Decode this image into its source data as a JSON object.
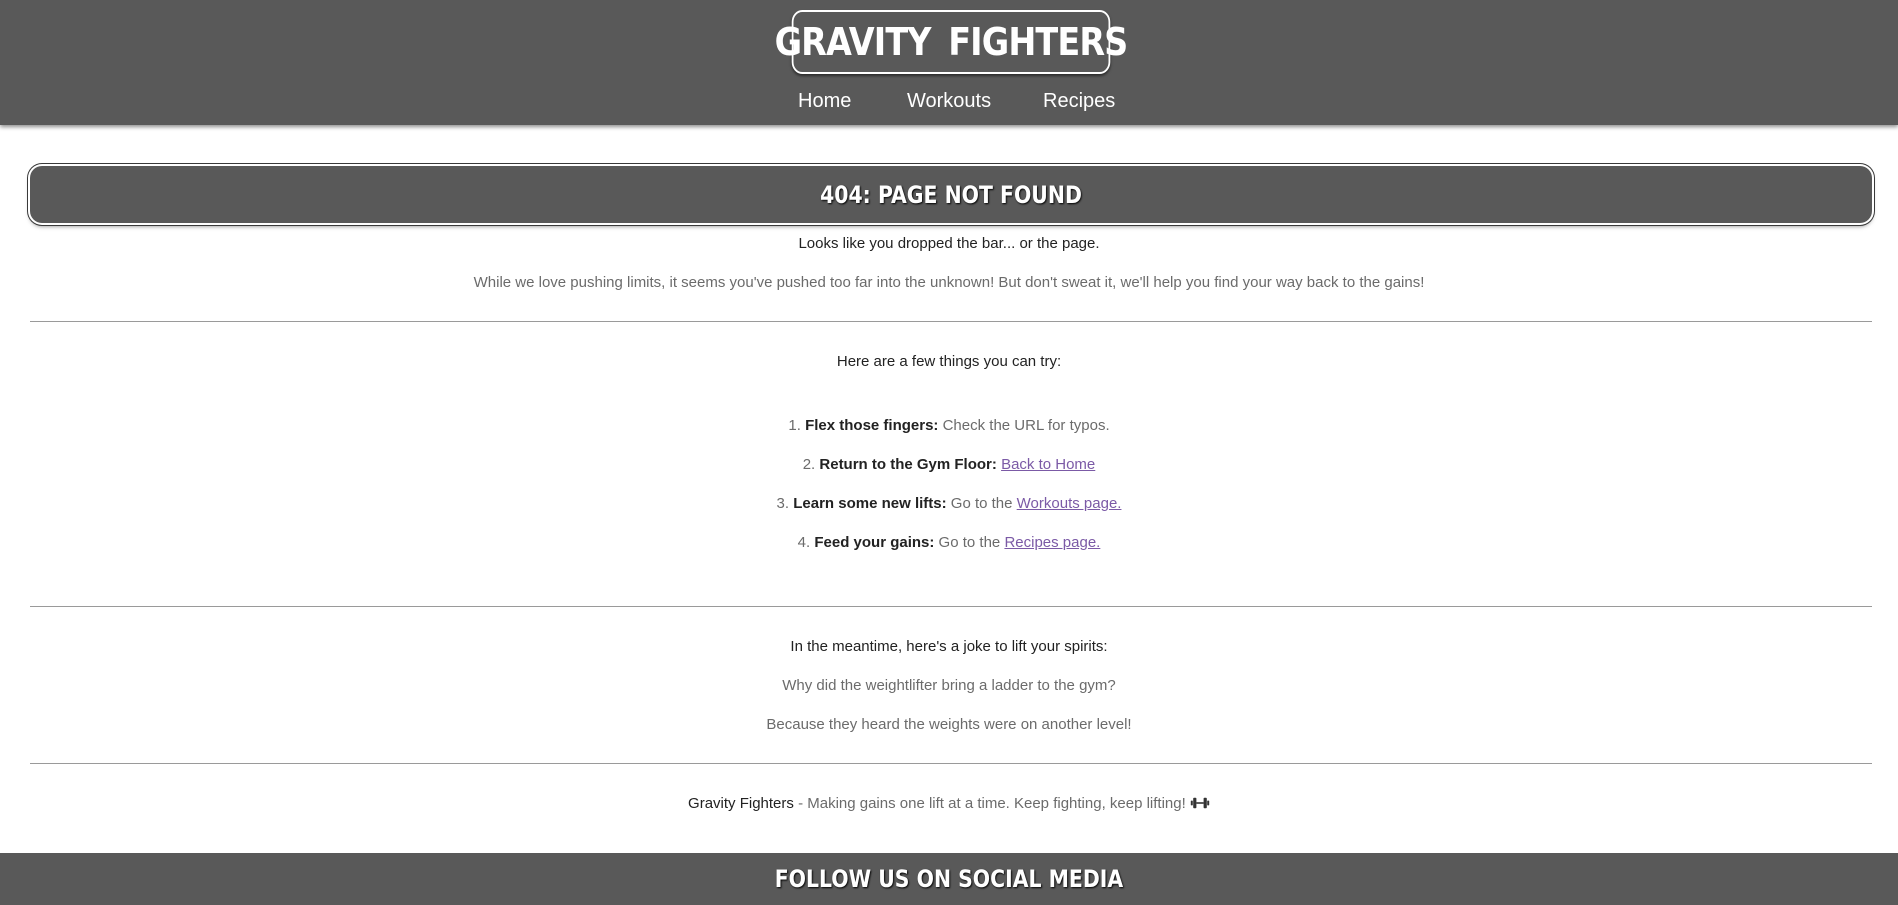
{
  "header": {
    "logo_left": "GRAVITY",
    "logo_right": "FIGHTERS",
    "logo_icon": "dumbbell-icon",
    "nav": [
      {
        "label": "Home"
      },
      {
        "label": "Workouts"
      },
      {
        "label": "Recipes"
      }
    ]
  },
  "error": {
    "title": "404: PAGE NOT FOUND",
    "subtitle": "Looks like you dropped the bar... or the page.",
    "message": "While we love pushing limits, it seems you've pushed too far into the unknown! But don't sweat it, we'll help you find your way back to the gains!"
  },
  "tips": {
    "heading": "Here are a few things you can try:",
    "items": [
      {
        "number": "1.",
        "label": "Flex those fingers:",
        "text": "Check the URL for typos.",
        "link": ""
      },
      {
        "number": "2.",
        "label": "Return to the Gym Floor:",
        "text": "",
        "link": "Back to Home"
      },
      {
        "number": "3.",
        "label": "Learn some new lifts:",
        "text": "Go to the",
        "link": "Workouts page."
      },
      {
        "number": "4.",
        "label": "Feed your gains:",
        "text": "Go to the",
        "link": "Recipes page."
      }
    ]
  },
  "joke": {
    "heading": "In the meantime, here's a joke to lift your spirits:",
    "question": "Why did the weightlifter bring a ladder to the gym?",
    "answer": "Because they heard the weights were on another level!"
  },
  "tagline": {
    "brand": "Gravity Fighters",
    "text": "- Making gains one lift at a time. Keep fighting, keep lifting!",
    "icon": "dumbbell-icon"
  },
  "footer": {
    "heading": "FOLLOW US ON SOCIAL MEDIA"
  },
  "colors": {
    "header_bg": "#595959",
    "link": "#7b5aa6",
    "text": "#222222",
    "muted": "#6b6b6b"
  }
}
